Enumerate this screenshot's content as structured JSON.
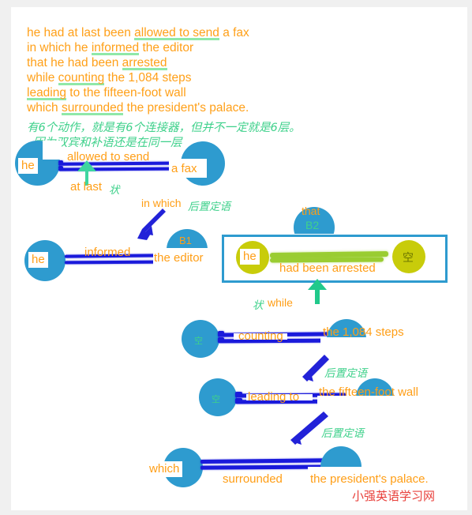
{
  "page": {
    "background": "#ffffff",
    "outer_background": "#f0f0f0",
    "accent_blue": "#2E9BCF",
    "accent_orange": "#FF9E16",
    "accent_green": "#3FD18B",
    "accent_yellow": "#C8CC0A",
    "line_blue": "#1A1ADB",
    "line_green": "#9ACD32",
    "watermark_red": "#E8413C"
  },
  "sentence": {
    "lines": [
      {
        "pre": "he had at last been ",
        "hl": "allowed to send",
        "post": " a fax"
      },
      {
        "pre": "in which he ",
        "hl": "informed",
        "post": " the editor"
      },
      {
        "pre": "that  he had been ",
        "hl": "arrested",
        "post": ""
      },
      {
        "pre": "while ",
        "hl": "counting",
        "post": " the 1,084 steps"
      },
      {
        "pre": "",
        "hl": "leading",
        "post": " to the fifteen-foot wall"
      },
      {
        "pre": "which ",
        "hl": "surrounded",
        "post": " the president's palace."
      }
    ]
  },
  "notes": {
    "note1": "有6个动作，就是有6个连接器，但并不一定就是6层。",
    "note2": "因为双宾和补语还是在同一层"
  },
  "rows": {
    "row1": {
      "subject": "he",
      "verb": "allowed to send",
      "object": "a fax",
      "adverbial": "at last",
      "adverbial_tag": "状"
    },
    "row2": {
      "connector": "in which",
      "connector_tag": "后置定语",
      "subject": "he",
      "verb": "informed",
      "object": "the editor",
      "object_level": "B1"
    },
    "clause": {
      "connector": "that",
      "connector_level": "B2",
      "subject": "he",
      "verb": "had been arrested",
      "object": "空"
    },
    "row3": {
      "connector_tag": "状",
      "connector": "while",
      "subject": "空",
      "verb": "counting",
      "object": "the 1,084 steps"
    },
    "row4": {
      "connector_tag": "后置定语",
      "subject": "空",
      "verb": "leading to",
      "object": "the fifteen-foot wall"
    },
    "row5": {
      "connector_tag": "后置定语",
      "subject": "which",
      "verb": "surrounded",
      "object": "the president's palace."
    }
  },
  "watermark": "小强英语学习网"
}
